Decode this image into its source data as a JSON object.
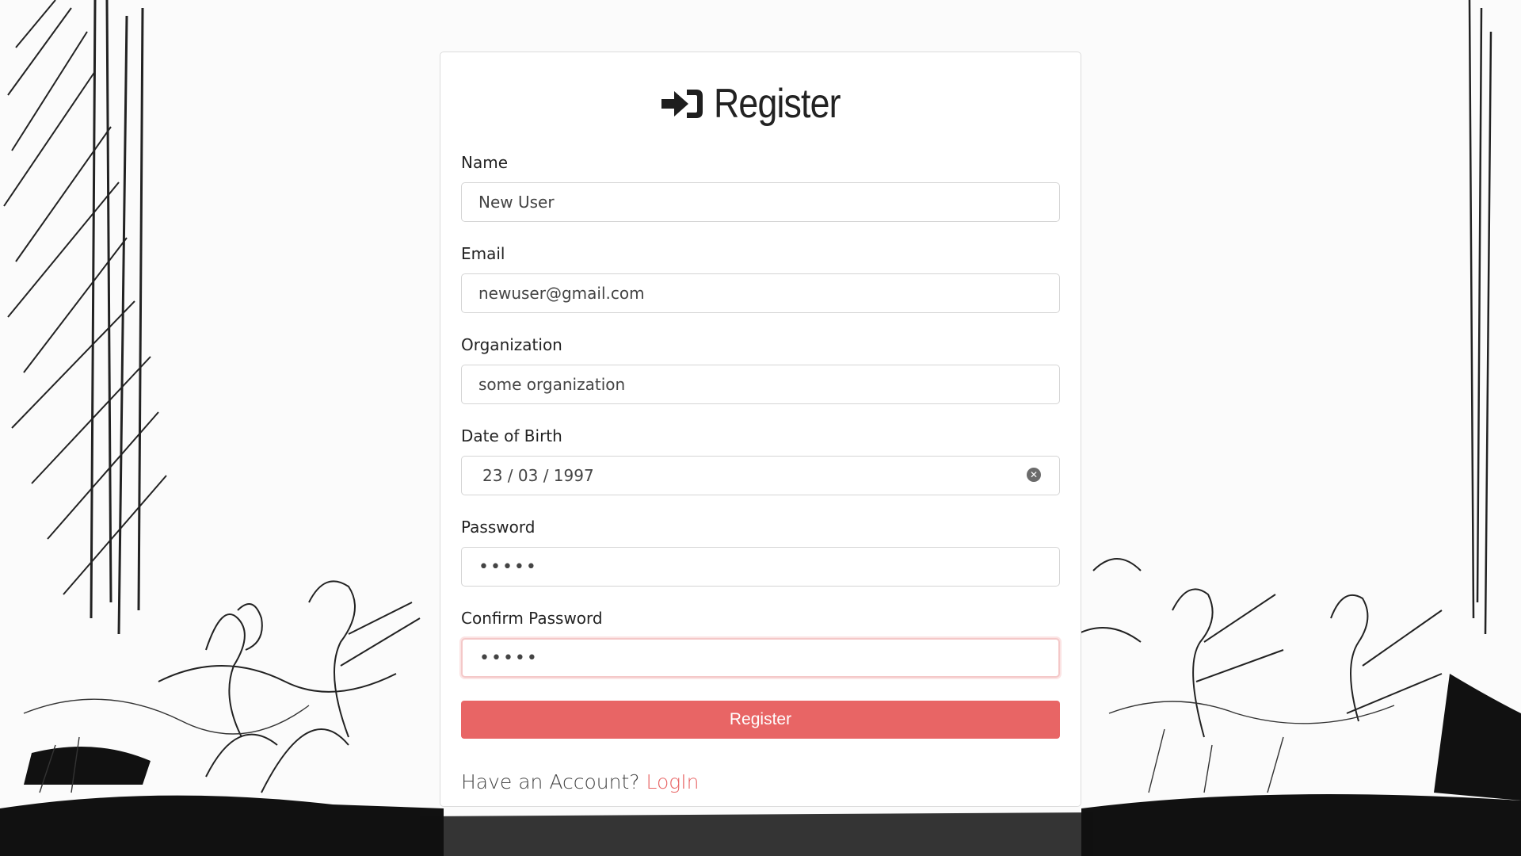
{
  "form": {
    "title": "Register",
    "title_icon": "sign-in-icon",
    "fields": {
      "name": {
        "label": "Name",
        "value": "New User"
      },
      "email": {
        "label": "Email",
        "value": "newuser@gmail.com"
      },
      "organization": {
        "label": "Organization",
        "value": "some organization"
      },
      "dob": {
        "label": "Date of Birth",
        "value": "23 / 03 / 1997"
      },
      "password": {
        "label": "Password",
        "value": "•••••"
      },
      "confirm_password": {
        "label": "Confirm Password",
        "value": "•••••",
        "state": "invalid"
      }
    },
    "submit_label": "Register",
    "footer_text": "Have an Account?",
    "login_link": "LogIn"
  },
  "colors": {
    "accent": "#e86565",
    "invalid_border": "#f4c8c8",
    "card_bg": "#ffffff"
  },
  "background": {
    "style": "pen-and-ink sketch of musicians"
  }
}
